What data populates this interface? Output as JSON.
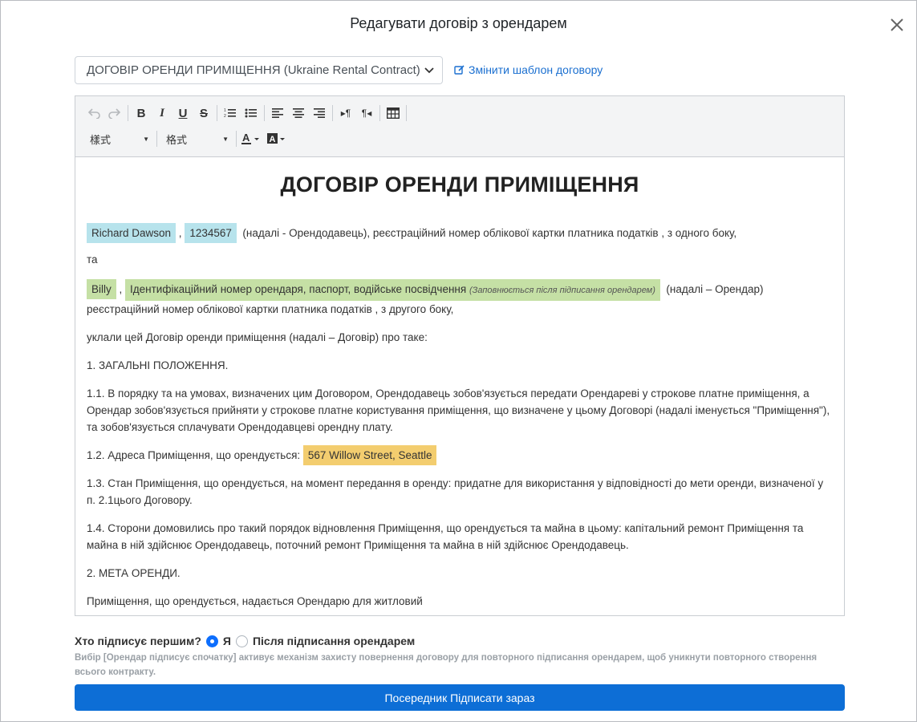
{
  "modal": {
    "title": "Редагувати договір з орендарем"
  },
  "template": {
    "selected": "ДОГОВІР ОРЕНДИ ПРИМІЩЕННЯ (Ukraine Rental Contract)",
    "change_label": "Змінити шаблон договору"
  },
  "toolbar": {
    "style_combo": "樣式",
    "format_combo": "格式",
    "buttons": [
      "undo-icon",
      "redo-icon",
      "bold-icon",
      "italic-icon",
      "underline-icon",
      "strikethrough-icon",
      "numbered-list-icon",
      "bulleted-list-icon",
      "align-left-icon",
      "align-center-icon",
      "align-right-icon",
      "ltr-icon",
      "rtl-icon",
      "table-icon",
      "text-color-icon",
      "background-color-icon"
    ]
  },
  "doc": {
    "title": "ДОГОВІР ОРЕНДИ ПРИМІЩЕННЯ",
    "landlord_name": "Richard Dawson",
    "landlord_id": "1234567",
    "landlord_text": "(надалі - Орендодавець), реєстраційний номер облікової картки платника податків , з одного боку,",
    "and": "та",
    "tenant_name": "Billy",
    "tenant_id_field": "Ідентифікаційний номер орендаря, паспорт, водійське посвідчення",
    "tenant_id_hint": "(Заповнюється після підписання орендарем)",
    "tenant_text": "(надалі – Орендар)",
    "tenant_text2": "реєстраційний номер облікової картки платника податків , з другого боку,",
    "concluded": "уклали цей Договір оренди приміщення (надалі – Договір) про таке:",
    "section1": "1. ЗАГАЛЬНІ ПОЛОЖЕННЯ.",
    "p1_1": "1.1. В порядку та на умовах, визначених цим Договором, Орендодавець зобов'язується передати Орендареві у строкове платне приміщення, а Орендар зобов'язується прийняти у строкове платне користування приміщення, що визначене у цьому Договорі (надалі іменується \"Приміщення\"), та зобов'язується сплачувати Орендодавцеві орендну плату.",
    "p1_2_prefix": "1.2. Адреса Приміщення, що орендується:",
    "address": "567 Willow Street, Seattle",
    "p1_3": "1.3. Стан Приміщення, що орендується, на момент передання в оренду: придатне для використання у відповідності до мети оренди, визначеної у п. 2.1цього Договору.",
    "p1_4": "1.4. Сторони домовились про такий порядок відновлення Приміщення, що орендується та майна в цьому: капітальний ремонт Приміщення та майна в ній здійснює Орендодавець, поточний ремонт Приміщення та майна в ній здійснює Орендодавець.",
    "section2": "2. МЕТА ОРЕНДИ.",
    "p2_1": "Приміщення, що орендується, надається Орендарю для житловий"
  },
  "signer": {
    "question": "Хто підписує першим?",
    "option_me": "Я",
    "option_after": "Після підписання орендарем",
    "selected": "me",
    "note": "Вибір [Орендар підписує спочатку] активує механізм захисту повернення договору для повторного підписання орендарем, щоб уникнути повторного створення всього контракту."
  },
  "sign_button": "Посередник Підписати зараз",
  "colors": {
    "primary": "#0d6ed6",
    "chip_blue": "#b7e3ec",
    "chip_green": "#c5e0a5",
    "chip_gold": "#f3cd6f"
  }
}
